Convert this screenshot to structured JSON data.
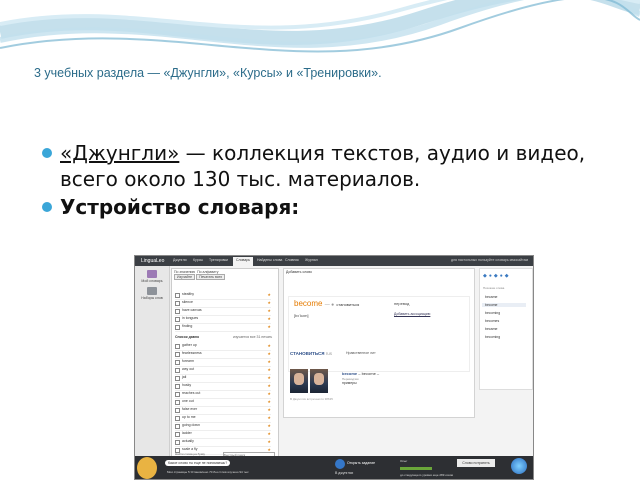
{
  "slide": {
    "title": "3 учебных раздела — «Джунгли», «Курсы» и «Тренировки».",
    "bullets": [
      {
        "link": "«Джунгли»",
        "text": " — коллекция текстов, аудио и видео, всего около 130 тыс. материалов."
      },
      {
        "text": "Устройство словаря:"
      }
    ],
    "accent_color": "#3aa6d8",
    "title_color": "#2c6c8a"
  },
  "screenshot": {
    "app_logo": "LinguaLeo",
    "top_tabs": [
      "Джунгли",
      "Курсы",
      "Тренировки",
      "Словарь",
      "Найдены слова",
      "Словник",
      "Журнал"
    ],
    "active_tab": "Словарь",
    "top_right": "для настольных пользуйте словарь ммосайтам",
    "left_nav": [
      "Мой словарь",
      "Наборы слов"
    ],
    "word_column": {
      "header_tabs": [
        "По значению",
        "По алфавиту"
      ],
      "buttons": [
        "Изучайте",
        "Печатать всех"
      ],
      "words_top": [
        "stealthy",
        "silence",
        "have canvas",
        "in tongues",
        "finding"
      ],
      "group_label": "Список давно",
      "group_count": "изучается все 31 печать",
      "words_bottom": [
        "gather up",
        "fearlessness",
        "forearm",
        "way out",
        "jail",
        "husky",
        "reaches out",
        "one out",
        "false ever",
        "up to me",
        "going down",
        "ladder",
        "actually",
        "scale a fly",
        "expensive"
      ],
      "footer": "Найти слова на букву",
      "search_placeholder": "Быстрый поиск"
    },
    "card": {
      "add_word": "Добавить слово",
      "word": "become",
      "translation": "становиться",
      "transcription": "[bɪˈkʌm]",
      "alt_translation": "перевод",
      "add_association": "Добавить ассоциацию",
      "subheader_ru": "СТАНОВИТЬСЯ",
      "subheader_en": "rus",
      "subheader_extra": "Нравственное лит",
      "example": "become",
      "example_translation": "– become –",
      "example_note": "Переводчик",
      "action": "примеры",
      "footer": "В Джунглях встречается 38635"
    },
    "right_column": {
      "header": "Похожие слова",
      "items": [
        "became",
        "become",
        "becoming",
        "becomes",
        "became",
        "becoming"
      ],
      "selected_index": 1
    },
    "bottom": {
      "bubble": "Какое слово ты еще не понимаешь?",
      "stats": "Мои страницы 5  Установлено 70  Лео  Слов изучено 94  тыс",
      "center_title": "Открыть задание",
      "center_sub": "В джунглях",
      "progress_label": "Опыт",
      "progress_fraction": 0.45,
      "progress_caption": "до следующего уровня еще 289 очков",
      "button": "Слово потратить"
    }
  }
}
